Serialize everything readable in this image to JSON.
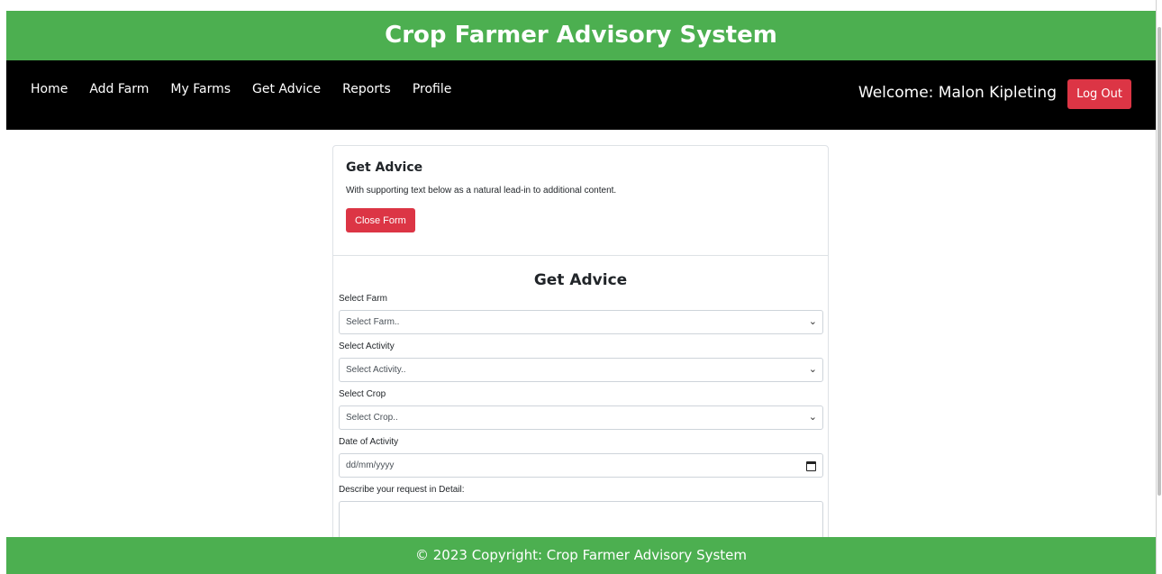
{
  "header": {
    "title": "Crop Farmer Advisory System"
  },
  "nav": {
    "items": [
      "Home",
      "Add Farm",
      "My Farms",
      "Get Advice",
      "Reports",
      "Profile"
    ],
    "welcome": "Welcome: Malon Kipleting",
    "logout_label": "Log Out"
  },
  "card": {
    "title": "Get Advice",
    "text": "With supporting text below as a natural lead-in to additional content.",
    "close_label": "Close Form"
  },
  "form": {
    "heading": "Get Advice",
    "farm": {
      "label": "Select Farm",
      "value": "Select Farm.."
    },
    "activity": {
      "label": "Select Activity",
      "value": "Select Activity.."
    },
    "crop": {
      "label": "Select Crop",
      "value": "Select Crop.."
    },
    "date": {
      "label": "Date of Activity",
      "placeholder": "dd/mm/yyyy"
    },
    "describe": {
      "label": "Describe your request in Detail:"
    }
  },
  "footer": {
    "text": "© 2023 Copyright: Crop Farmer Advisory System"
  },
  "colors": {
    "green": "#4caf50",
    "black": "#000000",
    "danger": "#dc3545"
  },
  "icons": {
    "select_arrow": "chevron-down-icon",
    "date_picker": "calendar-icon"
  }
}
